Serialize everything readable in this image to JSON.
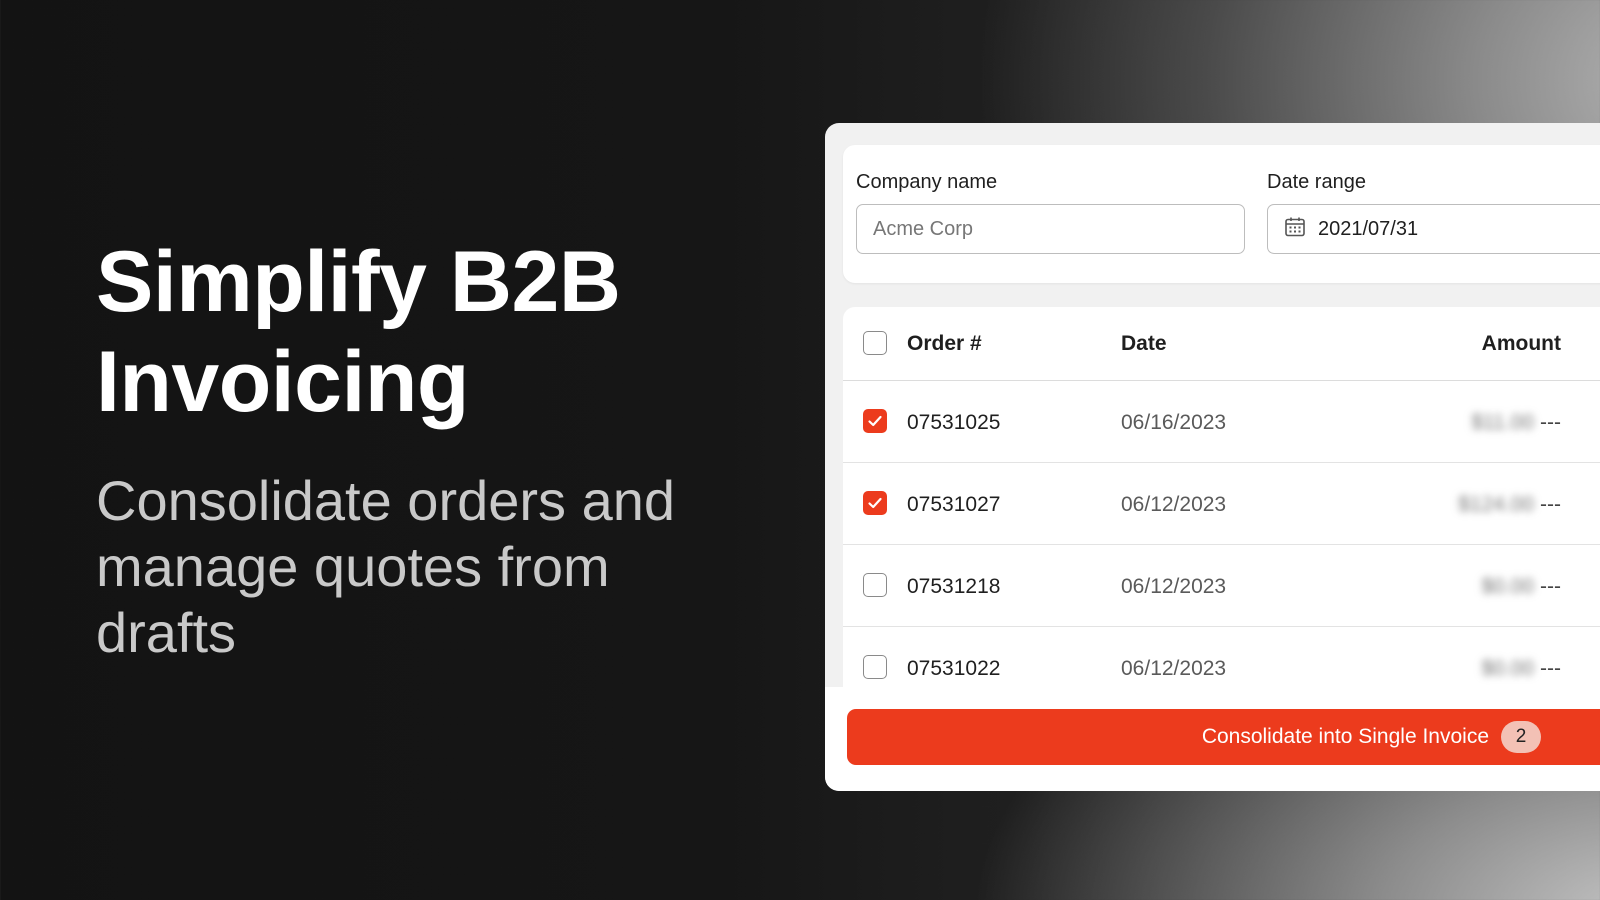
{
  "hero": {
    "title_line1": "Simplify B2B",
    "title_line2": "Invoicing",
    "subtitle": "Consolidate orders and manage quotes from drafts"
  },
  "filters": {
    "company_label": "Company name",
    "company_placeholder": "Acme Corp",
    "date_label": "Date range",
    "date_value": "2021/07/31"
  },
  "table": {
    "headers": {
      "order": "Order #",
      "date": "Date",
      "amount": "Amount"
    },
    "rows": [
      {
        "order": "07531025",
        "date": "06/16/2023",
        "amount_blurred": "$11.00",
        "amount_suffix": "---",
        "checked": true
      },
      {
        "order": "07531027",
        "date": "06/12/2023",
        "amount_blurred": "$124.00",
        "amount_suffix": "---",
        "checked": true
      },
      {
        "order": "07531218",
        "date": "06/12/2023",
        "amount_blurred": "$0.00",
        "amount_suffix": "---",
        "checked": false
      },
      {
        "order": "07531022",
        "date": "06/12/2023",
        "amount_blurred": "$0.00",
        "amount_suffix": "---",
        "checked": false
      }
    ]
  },
  "cta": {
    "label": "Consolidate into Single Invoice",
    "count": "2"
  },
  "colors": {
    "accent": "#ec3b1d",
    "badge_bg": "#f3c1b5"
  }
}
